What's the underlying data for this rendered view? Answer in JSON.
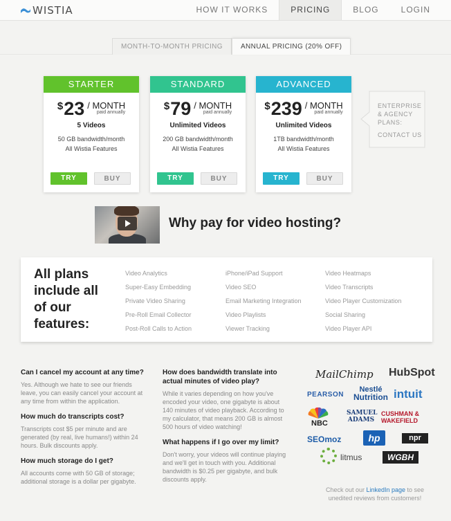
{
  "header": {
    "logo_text": "WISTIA",
    "nav": [
      {
        "label": "HOW IT WORKS"
      },
      {
        "label": "PRICING",
        "active": true
      },
      {
        "label": "BLOG"
      },
      {
        "label": "LOGIN"
      }
    ]
  },
  "tabs": {
    "monthly": "MONTH-TO-MONTH PRICING",
    "annual": "ANNUAL PRICING (20% OFF)",
    "active": "annual"
  },
  "plans": [
    {
      "name": "STARTER",
      "currency": "$",
      "price": "23",
      "period": "/ MONTH",
      "billing": "paid annually",
      "videos": "5 Videos",
      "bandwidth": "50 GB bandwidth/month",
      "features": "All Wistia Features",
      "try": "TRY",
      "buy": "BUY",
      "color": "#61c22c"
    },
    {
      "name": "STANDARD",
      "currency": "$",
      "price": "79",
      "period": "/ MONTH",
      "billing": "paid annually",
      "videos": "Unlimited Videos",
      "bandwidth": "200 GB bandwidth/month",
      "features": "All Wistia Features",
      "try": "TRY",
      "buy": "BUY",
      "color": "#31c48f"
    },
    {
      "name": "ADVANCED",
      "currency": "$",
      "price": "239",
      "period": "/ MONTH",
      "billing": "paid annually",
      "videos": "Unlimited Videos",
      "bandwidth": "1TB bandwidth/month",
      "features": "All Wistia Features",
      "try": "TRY",
      "buy": "BUY",
      "color": "#27b4cf"
    }
  ],
  "enterprise": {
    "line1": "ENTERPRISE",
    "line2": "& AGENCY",
    "line3": "PLANS:",
    "contact": "CONTACT US"
  },
  "video": {
    "title": "Why pay for video hosting?"
  },
  "features": {
    "title": "All plans include all of our features:",
    "columns": [
      [
        "Video Analytics",
        "Super-Easy Embedding",
        "Private Video Sharing",
        "Pre-Roll Email Collector",
        "Post-Roll Calls to Action"
      ],
      [
        "iPhone/iPad Support",
        "Video SEO",
        "Email Marketing Integration",
        "Video Playlists",
        "Viewer Tracking"
      ],
      [
        "Video Heatmaps",
        "Video Transcripts",
        "Video Player Customization",
        "Social Sharing",
        "Video Player API"
      ]
    ]
  },
  "faq": [
    {
      "q": "Can I cancel my account at any time?",
      "a": "Yes. Although we hate to see our friends leave, you can easily cancel your account at any time from within the application."
    },
    {
      "q": "How much do transcripts cost?",
      "a": "Transcripts cost $5 per minute and are generated (by real, live humans!) within 24 hours. Bulk discounts apply."
    },
    {
      "q": "How much storage do I get?",
      "a": "All accounts come with 50 GB of storage; additional storage is a dollar per gigabyte."
    },
    {
      "q": "How does bandwidth translate into actual minutes of video play?",
      "a": "While it varies depending on how you've encoded your video, one gigabyte is about 140 minutes of video playback. According to my calculator, that means 200 GB is almost 500 hours of video watching!"
    },
    {
      "q": "What happens if I go over my limit?",
      "a": "Don't worry, your videos will continue playing and we'll get in touch with you. Additional bandwidth is $0.25 per gigabyte, and bulk discounts apply."
    }
  ],
  "customers": {
    "mailchimp": "MailChimp",
    "hubspot": "HubSpot",
    "pearson": "PEARSON",
    "nestle_top": "Nestlé",
    "nestle_bottom": "Nutrition",
    "intuit": "intuit",
    "nbc": "NBC",
    "samuel_adams": "SAMUEL ADAMS",
    "cushman_top": "CUSHMAN &",
    "cushman_bottom": "WAKEFIELD",
    "seomoz": "SEOmoz",
    "hp": "hp",
    "npr": "npr",
    "litmus": "litmus",
    "wgbh": "WGBH"
  },
  "reviews": {
    "before": "Check out our ",
    "link": "LinkedIn page",
    "after": " to see unedited reviews from customers!"
  }
}
